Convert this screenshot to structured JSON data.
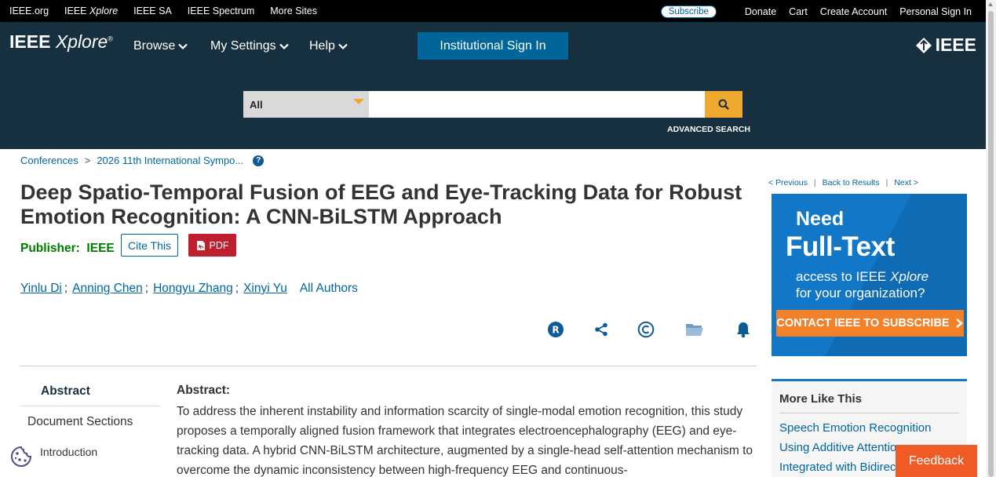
{
  "topbar": {
    "links": [
      "IEEE.org",
      "IEEE",
      "IEEE SA",
      "IEEE Spectrum",
      "More Sites"
    ],
    "xplore_suffix": "Xplore",
    "subscribe": "Subscribe",
    "right_links": [
      "Donate",
      "Cart",
      "Create Account",
      "Personal Sign In"
    ]
  },
  "header": {
    "logo_ieee": "IEEE",
    "logo_xplore": "Xplore",
    "logo_reg": "®",
    "nav": [
      "Browse",
      "My Settings",
      "Help"
    ],
    "institutional_signin": "Institutional Sign In",
    "brand": "IEEE",
    "search": {
      "scope": "All",
      "value": "",
      "placeholder": ""
    },
    "advanced_search": "ADVANCED SEARCH"
  },
  "breadcrumb": {
    "items": [
      "Conferences",
      "2026 11th International Sympo..."
    ],
    "separator": ">",
    "help": "?"
  },
  "article": {
    "title": "Deep Spatio-Temporal Fusion of EEG and Eye-Tracking Data for Robust Emotion Recognition: A CNN-BiLSTM Approach",
    "publisher_label": "Publisher:",
    "publisher": "IEEE",
    "cite_this": "Cite This",
    "pdf": "PDF",
    "authors": [
      "Yinlu Di",
      "Anning Chen",
      "Hongyu Zhang",
      "Xinyi Yu"
    ],
    "author_separator": ";",
    "all_authors": "All Authors",
    "action_icons": [
      "rights-icon",
      "share-icon",
      "copyright-icon",
      "folder-icon",
      "bell-icon"
    ]
  },
  "doc_nav": {
    "abstract": "Abstract",
    "document_sections": "Document Sections",
    "introduction": "Introduction"
  },
  "abstract": {
    "heading": "Abstract:",
    "text": "To address the inherent instability and information scarcity of single-modal emotion recognition, this study proposes a temporally aligned fusion framework that integrates electroencephalography (EEG) and eye-tracking data. A hybrid CNN-BiLSTM architecture, augmented by a single-head self-attention mechanism to overcome the dynamic inconsistency between high-frequency EEG and continuous-"
  },
  "pager": {
    "previous": "< Previous",
    "back": "Back to Results",
    "next": "Next >",
    "bar": "|"
  },
  "ad": {
    "need": "Need",
    "full_text": "Full-Text",
    "access_line1_pre": "access to IEEE ",
    "access_line1_em": "Xplore",
    "access_line2": "for your organization?",
    "cta": "CONTACT IEEE TO SUBSCRIBE"
  },
  "more_like_this": {
    "title": "More Like This",
    "items": [
      "Speech Emotion Recognition",
      "Using Additive Attention",
      "Integrated with Bidirec"
    ]
  },
  "feedback": "Feedback",
  "colors": {
    "header_bg": "#17303f",
    "link": "#0066a0",
    "accent_orange": "#f0a930",
    "pdf_red": "#be1e2d",
    "publisher_green": "#007a00",
    "feedback_orange": "#f05a24",
    "ad_blue": "#1177c6"
  }
}
